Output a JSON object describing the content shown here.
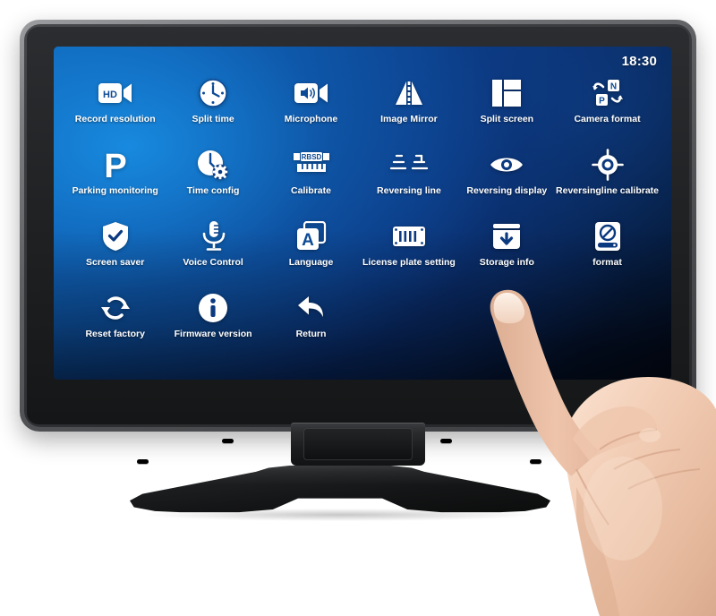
{
  "device": {
    "type": "car-dashcam-touchscreen-monitor",
    "bezel_color": "#3a3c3f",
    "frame_color": "#7e8083",
    "stand_color": "#1b1c1e"
  },
  "screen": {
    "background_colors": {
      "highlight": "#1172c4",
      "mid": "#0a3076",
      "dark": "#030c1f"
    },
    "status_bar": {
      "clock": "18:30"
    },
    "menu": {
      "columns": 6,
      "rows": 4,
      "items": [
        {
          "id": "record-resolution",
          "label": "Record resolution",
          "icon": "hd-camcorder-icon"
        },
        {
          "id": "split-time",
          "label": "Split time",
          "icon": "clock-icon"
        },
        {
          "id": "microphone",
          "label": "Microphone",
          "icon": "microphone-camcorder-icon"
        },
        {
          "id": "image-mirror",
          "label": "Image Mirror",
          "icon": "mirror-triangles-icon"
        },
        {
          "id": "split-screen",
          "label": "Split screen",
          "icon": "split-screen-grid-icon"
        },
        {
          "id": "camera-format",
          "label": "Camera format",
          "icon": "np-format-swap-icon"
        },
        {
          "id": "parking-monitoring",
          "label": "Parking monitoring",
          "icon": "parking-p-icon"
        },
        {
          "id": "time-config",
          "label": "Time config",
          "icon": "clock-gear-icon"
        },
        {
          "id": "calibrate",
          "label": "Calibrate",
          "icon": "rbsd-ruler-icon"
        },
        {
          "id": "reversing-line",
          "label": "Reversing line",
          "icon": "reversing-lines-icon"
        },
        {
          "id": "reversing-display",
          "label": "Reversing display",
          "icon": "eye-icon"
        },
        {
          "id": "reversingline-calibrate",
          "label": "Reversingline calibrate",
          "icon": "crosshair-target-icon"
        },
        {
          "id": "screen-saver",
          "label": "Screen saver",
          "icon": "shield-check-icon"
        },
        {
          "id": "voice-control",
          "label": "Voice Control",
          "icon": "microphone-icon"
        },
        {
          "id": "language",
          "label": "Language",
          "icon": "language-a-card-icon"
        },
        {
          "id": "license-plate-setting",
          "label": "License plate setting",
          "icon": "license-plate-icon"
        },
        {
          "id": "storage-info",
          "label": "Storage info",
          "icon": "storage-download-icon"
        },
        {
          "id": "format",
          "label": "format",
          "icon": "disk-forbidden-icon"
        },
        {
          "id": "reset-factory",
          "label": "Reset factory",
          "icon": "refresh-cycle-icon"
        },
        {
          "id": "firmware-version",
          "label": "Firmware version",
          "icon": "info-circle-icon"
        },
        {
          "id": "return",
          "label": "Return",
          "icon": "back-arrow-icon"
        }
      ]
    }
  },
  "overlay": {
    "hand": {
      "description": "right hand index finger touching screen",
      "skin_color": "#f0cdb6"
    }
  }
}
